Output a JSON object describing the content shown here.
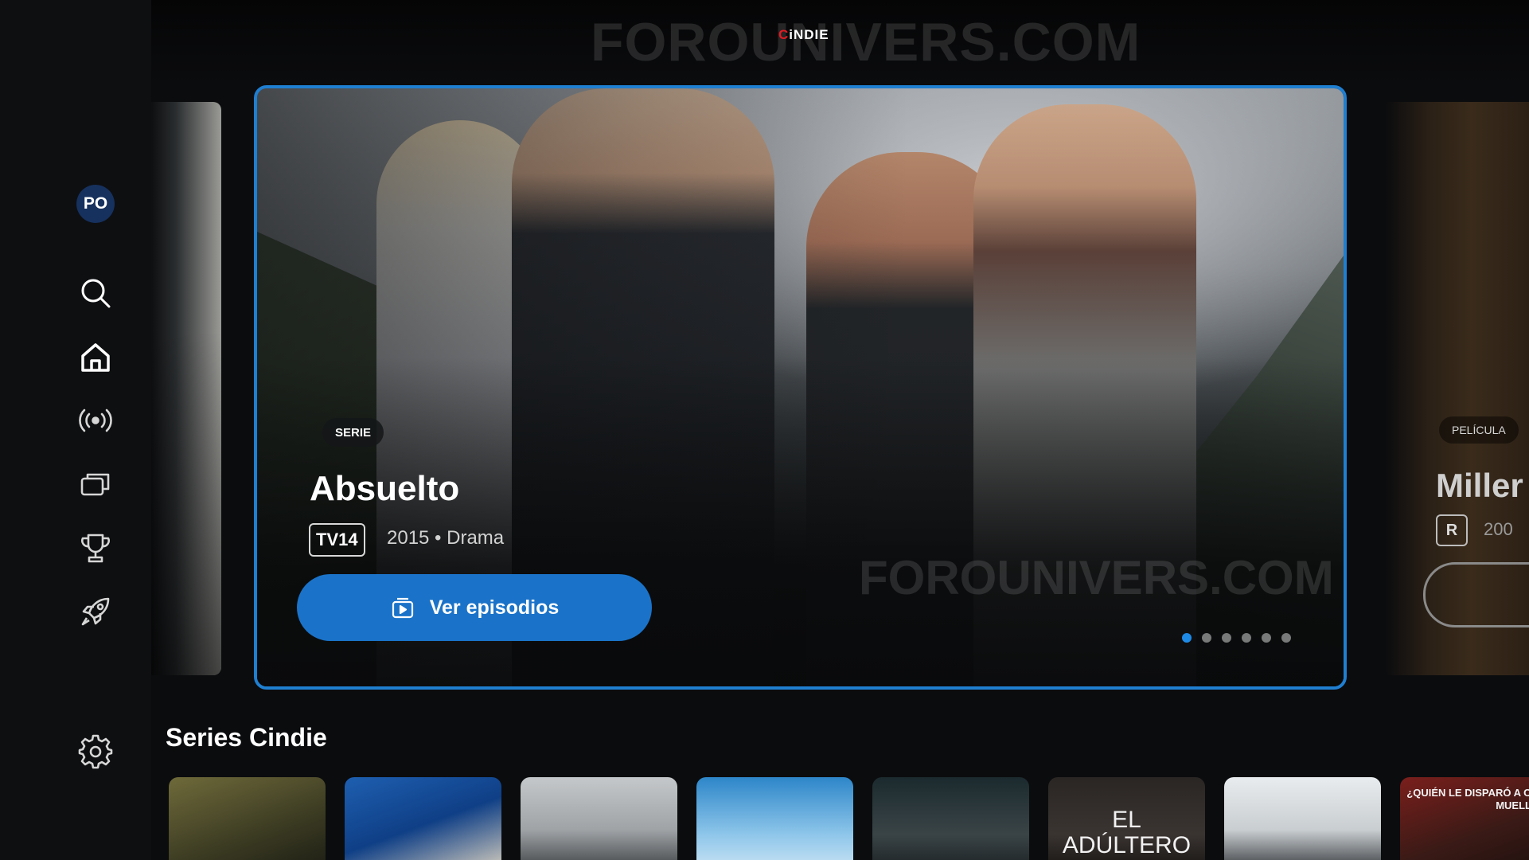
{
  "app": {
    "name": "CiNDIE",
    "watermark": "FOROUNIVERS.COM"
  },
  "sidebar": {
    "avatar_initials": "PO",
    "items": [
      {
        "id": "search",
        "icon": "search-icon"
      },
      {
        "id": "home",
        "icon": "home-icon",
        "active": true
      },
      {
        "id": "live",
        "icon": "broadcast-icon"
      },
      {
        "id": "collections",
        "icon": "cards-icon"
      },
      {
        "id": "awards",
        "icon": "trophy-icon"
      },
      {
        "id": "discover",
        "icon": "rocket-icon"
      },
      {
        "id": "settings",
        "icon": "gear-icon"
      }
    ]
  },
  "hero": {
    "chip": "SERIE",
    "title": "Absuelto",
    "rating": "TV14",
    "meta": "2015 • Drama",
    "cta_label": "Ver episodios",
    "slides_total": 6,
    "active_slide": 1,
    "watermark": "FOROUNIVERS.COM"
  },
  "peek_right": {
    "chip": "PELÍCULA",
    "title": "Miller",
    "rating": "R",
    "meta": "200"
  },
  "row": {
    "title": "Series Cindie",
    "items": [
      {
        "title": ""
      },
      {
        "title": ""
      },
      {
        "title": ""
      },
      {
        "title": ""
      },
      {
        "title": ""
      },
      {
        "title": "EL ADÚLTERO"
      },
      {
        "title": ""
      },
      {
        "title": "¿QUIÉN LE DISPARÓ A OTTO MUELLER?"
      }
    ]
  },
  "colors": {
    "accent": "#1f7fd1",
    "cta": "#1a73c8",
    "background": "#0b0c0e",
    "brand_red": "#e21b23"
  }
}
